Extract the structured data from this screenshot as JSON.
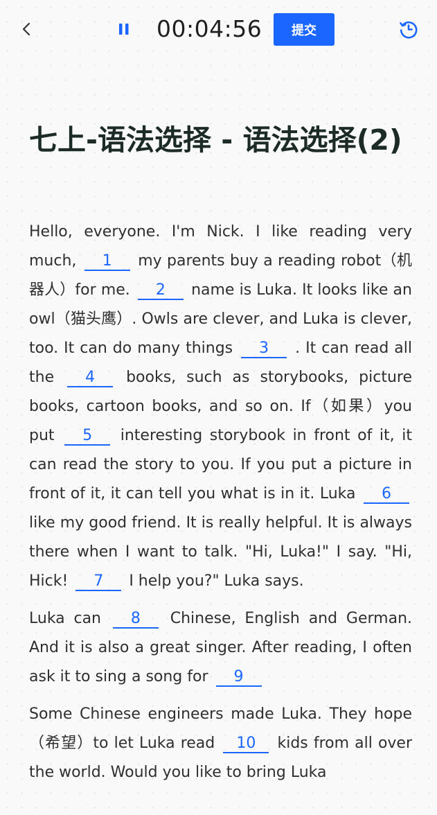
{
  "header": {
    "back_icon": "chevron-left-icon",
    "pause_icon": "pause-icon",
    "timer": "00:04:56",
    "submit_label": "提交",
    "history_icon": "history-clock-icon",
    "accent_color": "#1a66ff"
  },
  "title": "七上-语法选择 - 语法选择(2)",
  "paragraphs": [
    {
      "t0": "Hello, everyone. I'm Nick. I like reading very much,",
      "b1": "1",
      "t1": "my parents buy a reading robot（机器人）for me.",
      "b2": "2",
      "t2": "name is Luka. It looks like an owl（猫头鹰）. Owls are clever, and Luka is clever, too. It can do many things",
      "b3": "3",
      "t3": ". It can read all the",
      "b4": "4",
      "t4": "books, such as storybooks, picture books, cartoon books, and so on. If（如果）you put",
      "b5": "5",
      "t5": "interesting storybook in front of it, it can read the story to you. If you put a picture in front of it, it can tell you what is in it. Luka",
      "b6": "6",
      "t6": "like my good friend. It is really helpful. It is always there when I want to talk. \"Hi, Luka!\" I say. \"Hi, Hick!",
      "b7": "7",
      "t7": "I help you?\" Luka says."
    },
    {
      "t0": "Luka can",
      "b8": "8",
      "t1": "Chinese, English and German. And it is also a great singer. After reading, I often ask it to sing a song for",
      "b9": "9"
    },
    {
      "t0": "Some Chinese engineers made Luka. They hope（希望）to let Luka read",
      "b10": "10",
      "t1": "kids from all over the world. Would you like to bring Luka"
    }
  ]
}
